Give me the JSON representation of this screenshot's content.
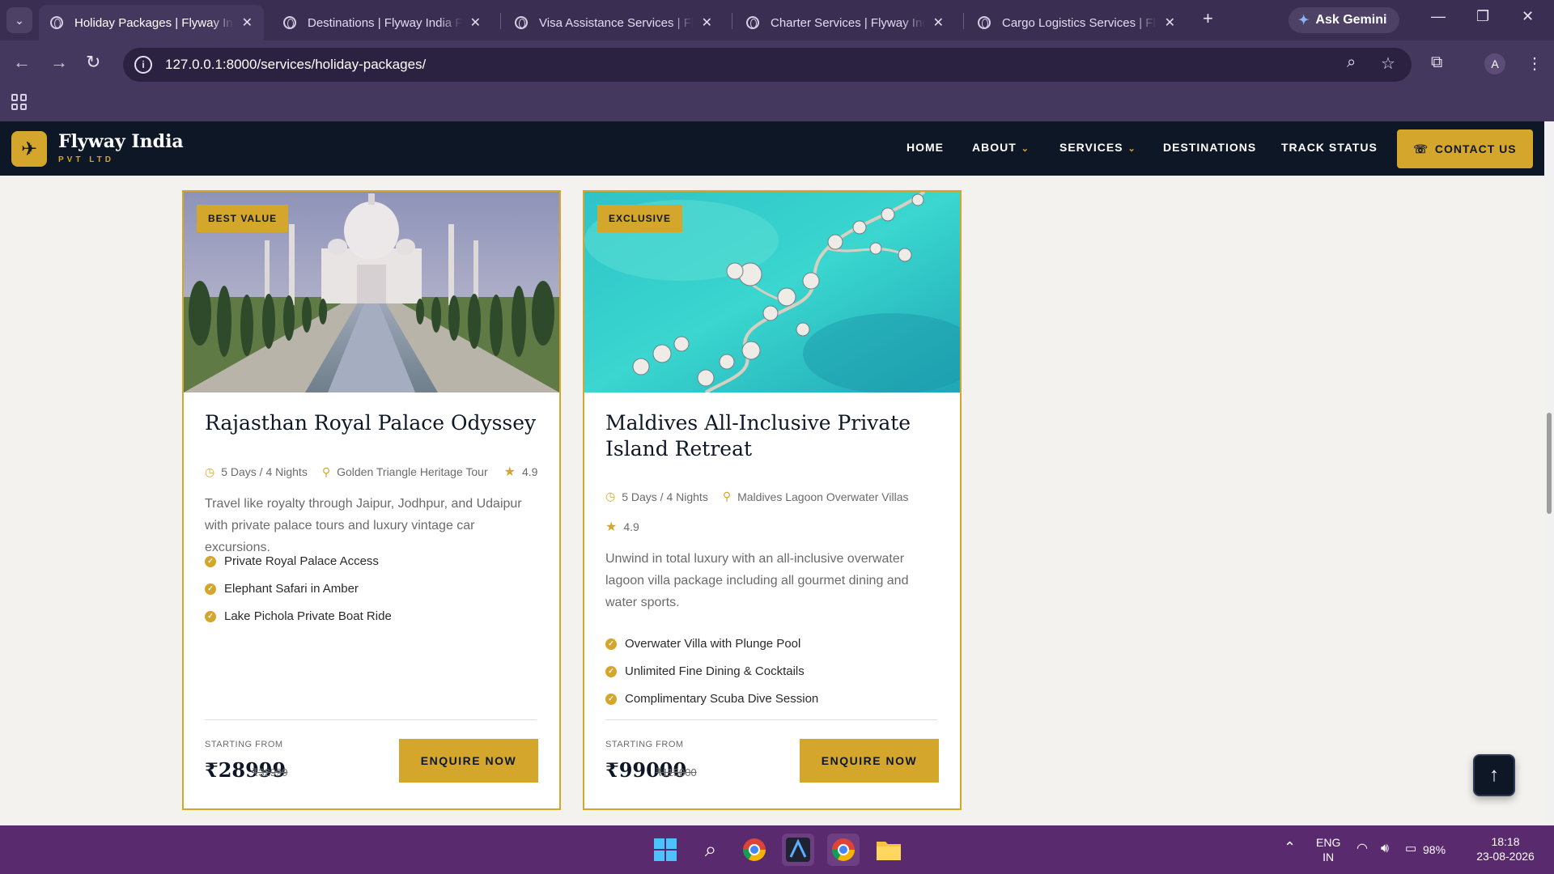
{
  "browser": {
    "tabs": [
      {
        "title": "Holiday Packages | Flyway India",
        "active": true
      },
      {
        "title": "Destinations | Flyway India Pvt",
        "active": false
      },
      {
        "title": "Visa Assistance Services | Flyw",
        "active": false
      },
      {
        "title": "Charter Services | Flyway India",
        "active": false
      },
      {
        "title": "Cargo Logistics Services | Flyw",
        "active": false
      }
    ],
    "gemini_label": "Ask Gemini",
    "url": "127.0.0.1:8000/services/holiday-packages/",
    "profile_initial": "A"
  },
  "site": {
    "brand_name": "Flyway India",
    "brand_sub": "PVT LTD",
    "nav": {
      "home": "HOME",
      "about": "ABOUT",
      "services": "SERVICES",
      "destinations": "DESTINATIONS",
      "track": "TRACK STATUS"
    },
    "contact_label": "CONTACT US",
    "accent_color": "#d4a72c",
    "header_color": "#0e1726"
  },
  "packages": [
    {
      "badge": "BEST VALUE",
      "title": "Rajasthan Royal Palace Odyssey",
      "duration": "5 Days / 4 Nights",
      "location": "Golden Triangle Heritage Tour",
      "rating": "4.9",
      "description": "Travel like royalty through Jaipur, Jodhpur, and Udaipur with private palace tours and luxury vintage car excursions.",
      "features": [
        "Private Royal Palace Access",
        "Elephant Safari in Amber",
        "Lake Pichola Private Boat Ride"
      ],
      "from_label": "STARTING FROM",
      "price": "₹28999",
      "old_price": "₹32999",
      "cta": "ENQUIRE NOW"
    },
    {
      "badge": "EXCLUSIVE",
      "title": "Maldives All-Inclusive Private Island Retreat",
      "duration": "5 Days / 4 Nights",
      "location": "Maldives Lagoon Overwater Villas",
      "rating": "4.9",
      "description": "Unwind in total luxury with an all-inclusive overwater lagoon villa package including all gourmet dining and water sports.",
      "features": [
        "Overwater Villa with Plunge Pool",
        "Unlimited Fine Dining & Cocktails",
        "Complimentary Scuba Dive Session"
      ],
      "from_label": "STARTING FROM",
      "price": "₹99000",
      "old_price": "₹115000",
      "cta": "ENQUIRE NOW"
    }
  ],
  "taskbar": {
    "lang_line1": "ENG",
    "lang_line2": "IN",
    "battery": "98%",
    "time": "18:18",
    "date": "23-08-2026"
  }
}
